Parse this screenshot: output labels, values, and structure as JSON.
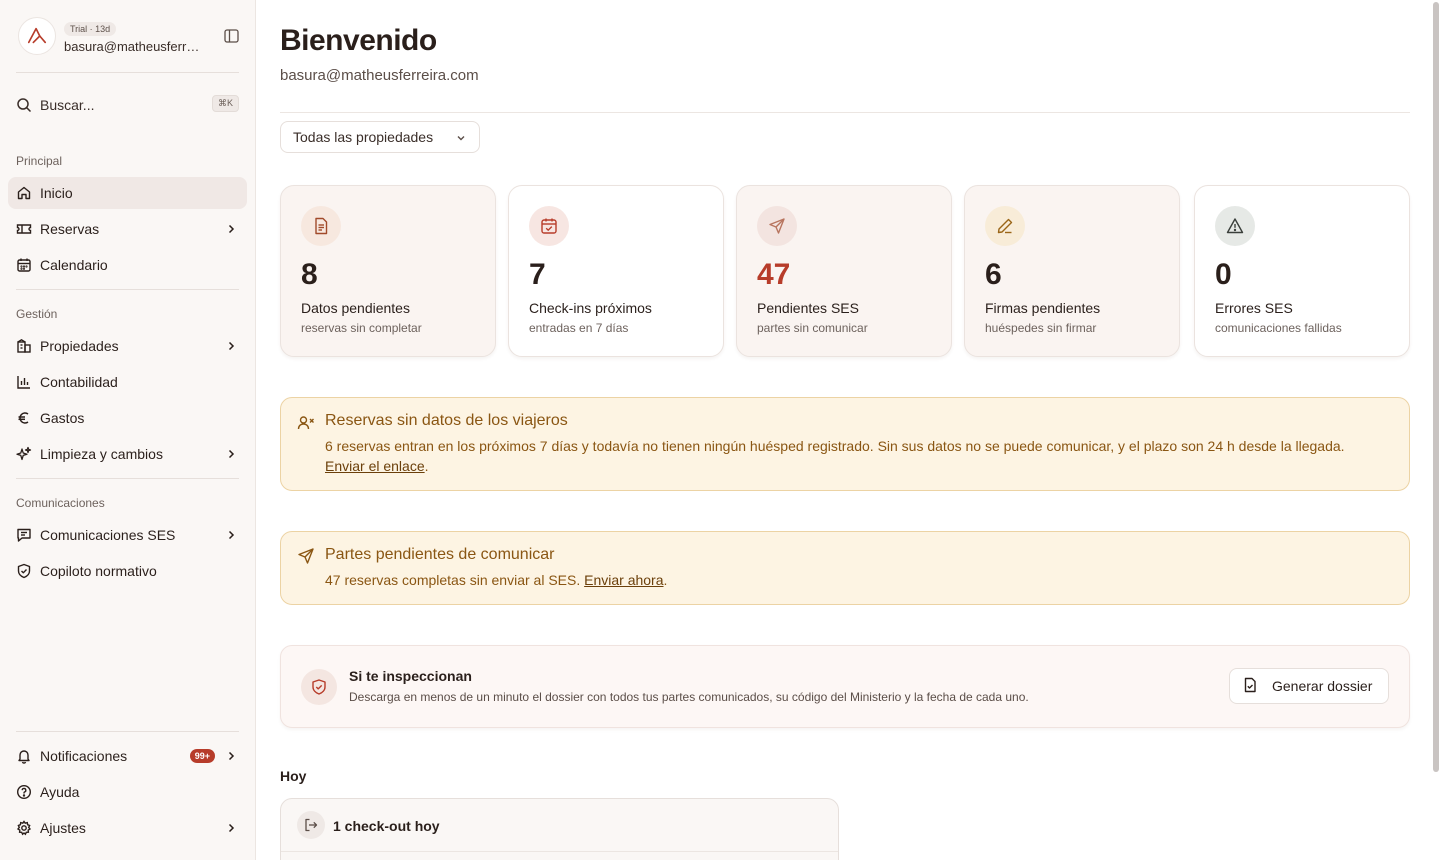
{
  "account": {
    "badge": "Trial · 13d",
    "email": "basura@matheusferreira.com"
  },
  "search": {
    "label": "Buscar...",
    "shortcut": "⌘K"
  },
  "sidebar": {
    "sections": [
      {
        "label": "Principal"
      },
      {
        "label": "Gestión"
      },
      {
        "label": "Comunicaciones"
      }
    ],
    "items": [
      {
        "label": "Inicio",
        "icon": "home-icon",
        "active": true
      },
      {
        "label": "Reservas",
        "icon": "ticket-icon"
      },
      {
        "label": "Calendario",
        "icon": "calendar-icon"
      },
      {
        "label": "Propiedades",
        "icon": "building-icon"
      },
      {
        "label": "Contabilidad",
        "icon": "bar-chart-icon"
      },
      {
        "label": "Gastos",
        "icon": "euro-icon"
      },
      {
        "label": "Limpieza y cambios",
        "icon": "sparkles-icon"
      },
      {
        "label": "Comunicaciones SES",
        "icon": "message-icon"
      },
      {
        "label": "Copiloto normativo",
        "icon": "shield-check-icon"
      }
    ],
    "bottom": [
      {
        "label": "Notificaciones",
        "icon": "bell-icon",
        "badge": "99+"
      },
      {
        "label": "Ayuda",
        "icon": "help-circle-icon"
      },
      {
        "label": "Ajustes",
        "icon": "gear-icon"
      }
    ]
  },
  "header": {
    "title": "Bienvenido",
    "email": "basura@matheusferreira.com"
  },
  "filter": {
    "value": "Todas las propiedades"
  },
  "stats": [
    {
      "value": "8",
      "label": "Datos pendientes",
      "sub": "reservas sin completar",
      "icon": "document-icon"
    },
    {
      "value": "7",
      "label": "Check-ins próximos",
      "sub": "entradas en 7 días",
      "icon": "calendar-check-icon"
    },
    {
      "value": "47",
      "label": "Pendientes SES",
      "sub": "partes sin comunicar",
      "icon": "send-icon"
    },
    {
      "value": "6",
      "label": "Firmas pendientes",
      "sub": "huéspedes sin firmar",
      "icon": "pen-icon"
    },
    {
      "value": "0",
      "label": "Errores SES",
      "sub": "comunicaciones fallidas",
      "icon": "warning-icon"
    }
  ],
  "alerts": [
    {
      "title": "Reservas sin datos de los viajeros",
      "text": "6 reservas entran en los próximos 7 días y todavía no tienen ningún huésped registrado. Sin sus datos no se puede comunicar, y el plazo son 24 h desde la llegada. ",
      "link": "Enviar el enlace",
      "after": "."
    },
    {
      "title": "Partes pendientes de comunicar",
      "text": "47 reservas completas sin enviar al SES. ",
      "link": "Enviar ahora",
      "after": "."
    }
  ],
  "inspection": {
    "title": "Si te inspeccionan",
    "text": "Descarga en menos de un minuto el dossier con todos tus partes comunicados, su código del Ministerio y la fecha de cada uno.",
    "button": "Generar dossier"
  },
  "today": {
    "heading": "Hoy",
    "checkout": "1 check-out hoy"
  },
  "colors": {
    "accent": "#b73c2a",
    "warning_bg": "#fdf4e3",
    "warning_text": "#8a5613"
  }
}
